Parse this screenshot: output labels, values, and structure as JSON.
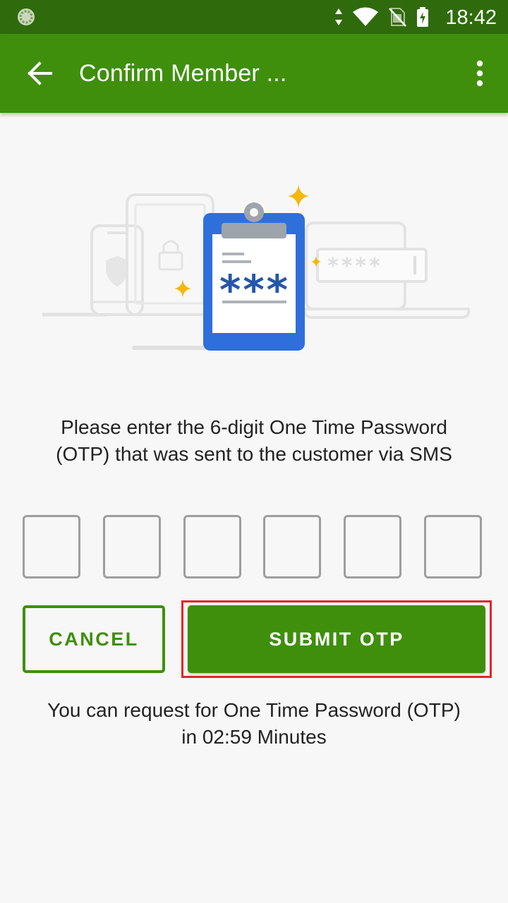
{
  "status_bar": {
    "time": "18:42",
    "icons": [
      "app-notification-icon",
      "data-arrows-icon",
      "wifi-icon",
      "no-sim-icon",
      "battery-charging-icon"
    ]
  },
  "app_bar": {
    "title": "Confirm Member ...",
    "back_icon": "arrow-back-icon",
    "menu_icon": "more-vert-icon"
  },
  "illustration": {
    "code_mask": "***",
    "password_mask": "****"
  },
  "otp": {
    "instruction": "Please enter the 6-digit One Time Password (OTP) that was sent to the customer via SMS",
    "digits": [
      "",
      "",
      "",
      "",
      "",
      ""
    ]
  },
  "buttons": {
    "cancel_label": "CANCEL",
    "submit_label": "SUBMIT OTP"
  },
  "request": {
    "line1": "You can request for One Time Password (OTP)",
    "line2": "in 02:59 Minutes"
  },
  "colors": {
    "primary": "#3f8f0d",
    "status_bar": "#2f6b0c",
    "highlight": "#e3242b",
    "accent_blue": "#2f6fdc",
    "sparkle": "#f5b70a"
  }
}
